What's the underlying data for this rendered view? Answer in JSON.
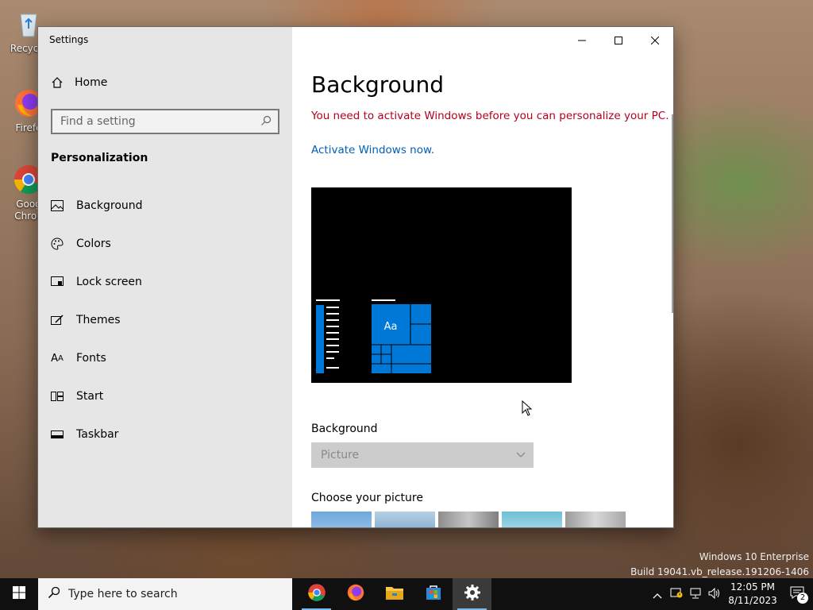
{
  "desktop": {
    "icons": [
      {
        "label": "Recycle",
        "icon": "recycle-bin-icon"
      },
      {
        "label": "Firefo",
        "icon": "firefox-icon"
      },
      {
        "label": "Goog Chron",
        "icon": "chrome-icon"
      }
    ]
  },
  "window": {
    "title": "Settings",
    "controls": {
      "minimize": "minimize-icon",
      "maximize": "maximize-icon",
      "close": "close-icon"
    }
  },
  "sidebar": {
    "home_label": "Home",
    "search_placeholder": "Find a setting",
    "section_heading": "Personalization",
    "items": [
      {
        "label": "Background",
        "icon": "picture-icon"
      },
      {
        "label": "Colors",
        "icon": "palette-icon"
      },
      {
        "label": "Lock screen",
        "icon": "lock-screen-icon"
      },
      {
        "label": "Themes",
        "icon": "themes-icon"
      },
      {
        "label": "Fonts",
        "icon": "fonts-icon"
      },
      {
        "label": "Start",
        "icon": "start-icon"
      },
      {
        "label": "Taskbar",
        "icon": "taskbar-icon"
      }
    ]
  },
  "content": {
    "title": "Background",
    "activation_warning": "You need to activate Windows before you can personalize your PC.",
    "activate_link": "Activate Windows now.",
    "preview": {
      "tile_label": "Aa",
      "accent_color": "#0078d7"
    },
    "background_label": "Background",
    "background_value": "Picture",
    "choose_picture_label": "Choose your picture"
  },
  "watermark": {
    "line1": "Windows 10 Enterprise",
    "line2": "Build 19041.vb_release.191206-1406"
  },
  "taskbar": {
    "search_placeholder": "Type here to search",
    "apps": [
      "chrome-icon",
      "firefox-icon",
      "file-explorer-icon",
      "store-icon",
      "settings-icon"
    ],
    "clock_time": "12:05 PM",
    "clock_date": "8/11/2023",
    "notification_count": "2"
  }
}
